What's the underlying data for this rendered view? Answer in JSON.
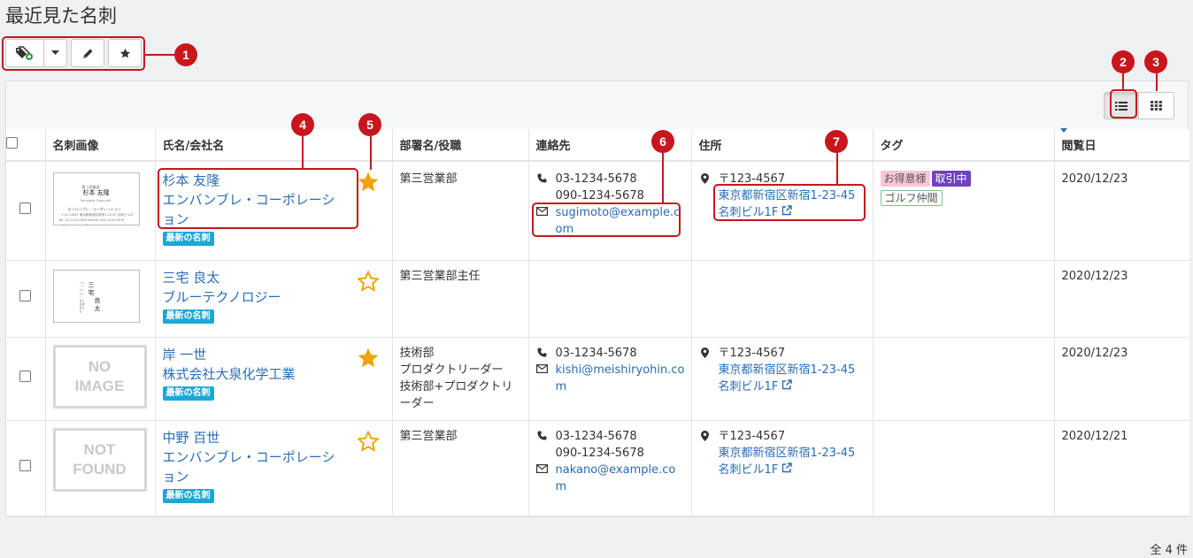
{
  "page": {
    "title": "最近見た名刺",
    "total": "全 4 件"
  },
  "toolbar": {
    "buttons": [
      {
        "icon": "tag-add-icon"
      },
      {
        "icon": "caret-down-icon"
      },
      {
        "icon": "pencil-icon"
      },
      {
        "icon": "star-icon"
      }
    ]
  },
  "view_toggle": {
    "active": "list",
    "options": [
      "list",
      "grid"
    ]
  },
  "table": {
    "headers": [
      "名刺画像",
      "氏名/会社名",
      "部署名/役職",
      "連絡先",
      "住所",
      "タグ",
      "閲覧日"
    ],
    "sorted_column": "閲覧日",
    "rows": [
      {
        "image": "card",
        "card": {
          "company_small": "第三営業部",
          "name": "杉本 友隆",
          "romaji": "Tomotaka Sugimoto",
          "company": "エンバンブレ・コーポレーション",
          "addr": "〒123-4567 東京都新宿区新宿1-23-45 名刺ビル1F",
          "tel": "Tel: 03-1234-5678  Mobile: 090-1234-5678",
          "mail": "Mail: sugimoto@example.com"
        },
        "name": "杉本 友隆",
        "company_l1": "エンバンブレ・コーポレーシ",
        "company_l2": "ョン",
        "badge": "最新の名刺",
        "starred": true,
        "dept_l1": "第三営業部",
        "dept_l2": "",
        "dept_l3": "",
        "dept_l4": "",
        "phone1": "03-1234-5678",
        "phone2": "090-1234-5678",
        "email_l1": "sugimoto@example.c",
        "email_l2": "om",
        "zip": "〒123-4567",
        "addr_l1": "東京都新宿区新宿1-23-45",
        "addr_l2": "名刺ビル1F",
        "tags": [
          "お得意様",
          "取引中",
          "ゴルフ仲間"
        ],
        "date": "2020/12/23"
      },
      {
        "image": "card-vertical",
        "card": {
          "name_v1": "三宅",
          "name_v2": "良太",
          "company_small": "ブルーテクノロジー 第三営業部主任"
        },
        "name": "三宅 良太",
        "company_l1": "ブルーテクノロジー",
        "company_l2": "",
        "badge": "最新の名刺",
        "starred": false,
        "dept_l1": "第三営業部主任",
        "date": "2020/12/23"
      },
      {
        "image": "no-image",
        "placeholder_l1": "NO",
        "placeholder_l2": "IMAGE",
        "name": "岸 一世",
        "company_l1": "株式会社大泉化学工業",
        "company_l2": "",
        "badge": "最新の名刺",
        "starred": true,
        "dept_l1": "技術部",
        "dept_l2": "プロダクトリーダー",
        "dept_l3": "技術部+プロダクトリ",
        "dept_l4": "ーダー",
        "phone1": "03-1234-5678",
        "phone2": "",
        "email_l1": "kishi@meishiryohin.co",
        "email_l2": "m",
        "zip": "〒123-4567",
        "addr_l1": "東京都新宿区新宿1-23-45",
        "addr_l2": "名刺ビル1F",
        "date": "2020/12/23"
      },
      {
        "image": "not-found",
        "placeholder_l1": "NOT",
        "placeholder_l2": "FOUND",
        "name": "中野 百世",
        "company_l1": "エンバンブレ・コーポレーシ",
        "company_l2": "ョン",
        "badge": "最新の名刺",
        "starred": false,
        "dept_l1": "第三営業部",
        "phone1": "03-1234-5678",
        "phone2": "090-1234-5678",
        "email_l1": "nakano@example.co",
        "email_l2": "m",
        "zip": "〒123-4567",
        "addr_l1": "東京都新宿区新宿1-23-45",
        "addr_l2": "名刺ビル1F",
        "date": "2020/12/21"
      }
    ]
  },
  "callouts": [
    "1",
    "2",
    "3",
    "4",
    "5",
    "6",
    "7"
  ],
  "colors": {
    "accent": "#2a6db5",
    "callout": "#c8161d",
    "star": "#f0a30a",
    "badge": "#1ea7d6",
    "tag_pink": "#f7c6d9",
    "tag_purple": "#6f42c1"
  }
}
